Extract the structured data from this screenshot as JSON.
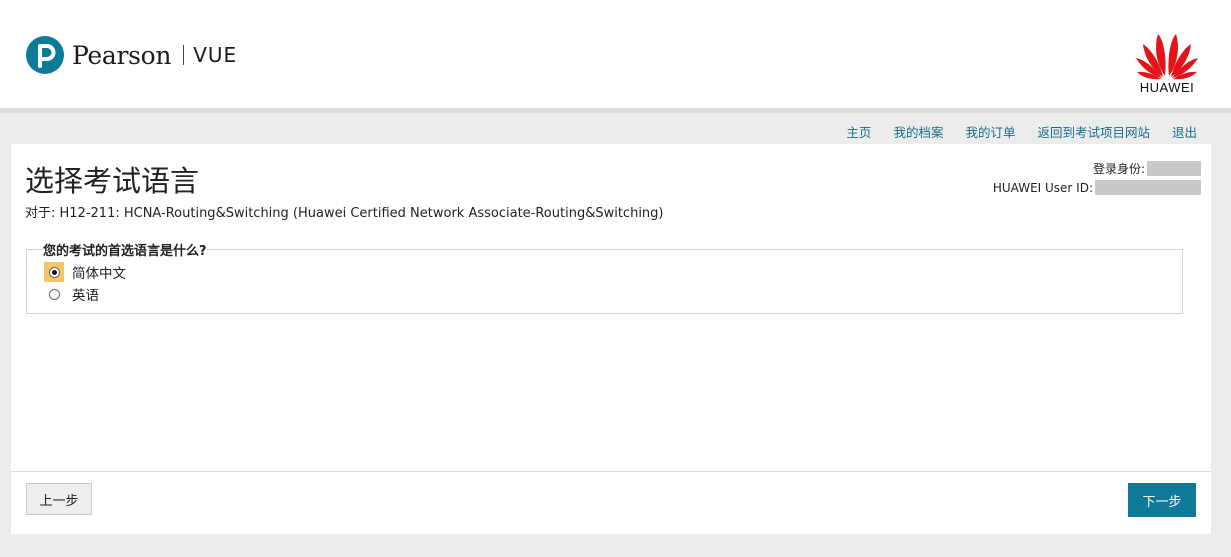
{
  "header": {
    "brand_name": "Pearson",
    "brand_product": "VUE",
    "partner_logo_text": "HUAWEI"
  },
  "nav": {
    "items": [
      {
        "label": "主页"
      },
      {
        "label": "我的档案"
      },
      {
        "label": "我的订单"
      },
      {
        "label": "返回到考试项目网站"
      },
      {
        "label": "退出"
      }
    ]
  },
  "main": {
    "title": "选择考试语言",
    "exam_for": "对于: H12-211: HCNA-Routing&Switching (Huawei Certified Network Associate-Routing&Switching)",
    "identity": {
      "logged_in_label": "登录身份:",
      "user_id_label": "HUAWEI User ID:"
    },
    "question": "您的考试的首选语言是什么?",
    "options": [
      {
        "label": "简体中文",
        "selected": true
      },
      {
        "label": "英语",
        "selected": false
      }
    ]
  },
  "footer": {
    "back_label": "上一步",
    "next_label": "下一步"
  },
  "colors": {
    "accent": "#0e7a97",
    "link": "#1a6e8a",
    "huawei_red": "#e4141b",
    "focus_highlight": "#f1c768"
  }
}
